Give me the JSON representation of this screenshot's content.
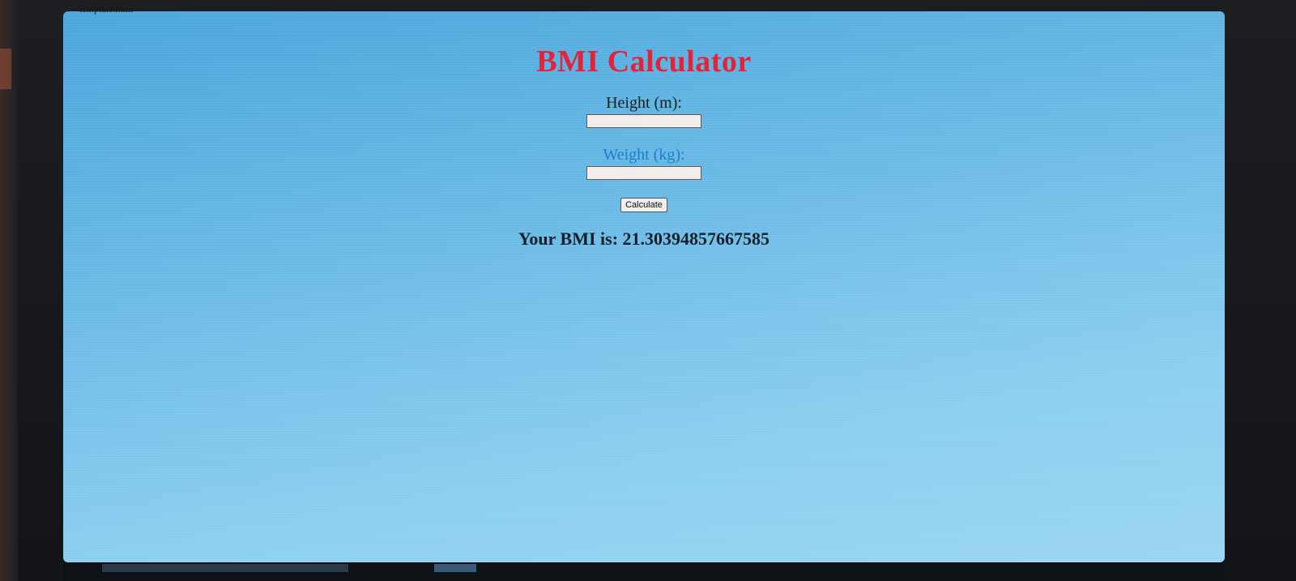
{
  "tab": {
    "title": "template.html"
  },
  "page": {
    "title": "BMI Calculator",
    "height_label": "Height (m):",
    "height_value": "",
    "weight_label": "Weight (kg):",
    "weight_value": "",
    "calculate_label": "Calculate",
    "result_text": "Your BMI is: 21.30394857667585"
  },
  "colors": {
    "title": "#e2233a",
    "background": "#6cbbe6",
    "weight_label": "#1a7fd0",
    "result": "#14202b"
  }
}
